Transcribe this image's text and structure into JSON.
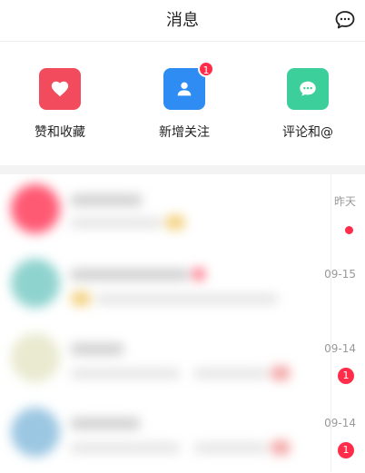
{
  "header": {
    "title": "消息",
    "chat_icon": "chat-bubble-icon"
  },
  "quick_actions": [
    {
      "label": "赞和收藏",
      "icon": "heart-icon",
      "color": "#f24b5d",
      "badge": ""
    },
    {
      "label": "新增关注",
      "icon": "person-icon",
      "color": "#2e8cf2",
      "badge": "1"
    },
    {
      "label": "评论和@",
      "icon": "comment-icon",
      "color": "#3ccf9b",
      "badge": ""
    }
  ],
  "messages": [
    {
      "time": "昨天",
      "indicator": "dot",
      "count": ""
    },
    {
      "time": "09-15",
      "indicator": "none",
      "count": ""
    },
    {
      "time": "09-14",
      "indicator": "count",
      "count": "1"
    },
    {
      "time": "09-14",
      "indicator": "count",
      "count": "1"
    }
  ]
}
